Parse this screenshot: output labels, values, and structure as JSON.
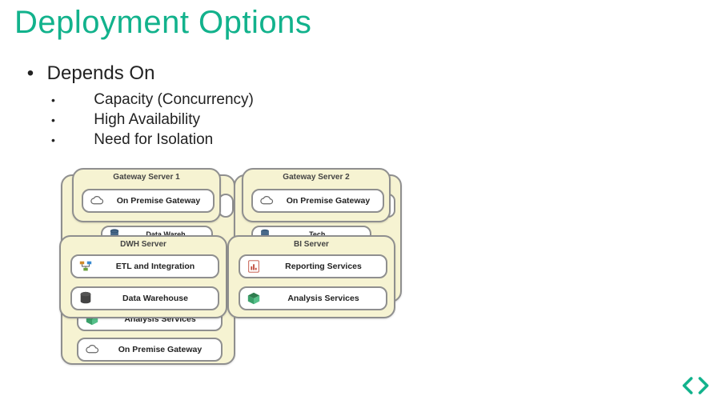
{
  "title": "Deployment Options",
  "bullets": {
    "l1": "Depends On",
    "subs": [
      "Capacity (Concurrency)",
      "High Availability",
      "Need for Isolation"
    ]
  },
  "diagram": {
    "tall_card_ghost_pill_text": "Analysis Services",
    "cards": {
      "gw1": {
        "title": "Gateway Server 1",
        "item": "On Premise Gateway"
      },
      "gw2": {
        "title": "Gateway Server 2",
        "item": "On Premise Gateway"
      },
      "dwh": {
        "title": "DWH Server",
        "items": [
          "ETL and Integration",
          "Data Warehouse"
        ]
      },
      "bi": {
        "title": "BI Server",
        "items": [
          "Reporting Services",
          "Analysis Services"
        ]
      },
      "bottom_pill": "On Premise Gateway",
      "mid_cut": "Data Wareh",
      "gw2_behind_cut": "Tech..."
    }
  },
  "icons": {
    "cloud": "cloud-icon",
    "etl": "etl-icon",
    "db": "database-icon",
    "report": "report-icon",
    "cube": "cube-icon"
  }
}
